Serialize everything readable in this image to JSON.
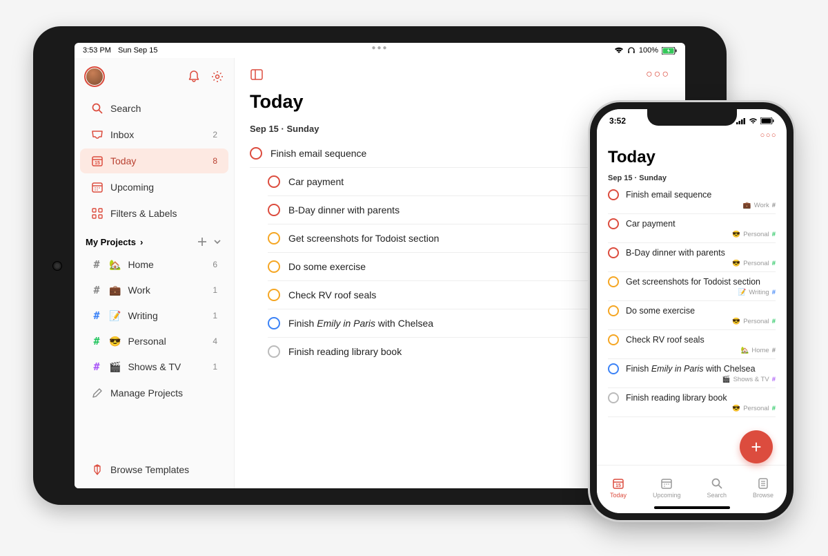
{
  "ipad": {
    "status": {
      "time": "3:53 PM",
      "date": "Sun Sep 15",
      "battery": "100%"
    },
    "sidebar": {
      "search": "Search",
      "nav": [
        {
          "label": "Inbox",
          "count": "2"
        },
        {
          "label": "Today",
          "count": "8"
        },
        {
          "label": "Upcoming",
          "count": ""
        },
        {
          "label": "Filters & Labels",
          "count": ""
        }
      ],
      "projects_header": "My Projects",
      "projects": [
        {
          "emoji": "🏡",
          "label": "Home",
          "count": "6",
          "hash": "gray"
        },
        {
          "emoji": "💼",
          "label": "Work",
          "count": "1",
          "hash": "gray"
        },
        {
          "emoji": "📝",
          "label": "Writing",
          "count": "1",
          "hash": "blue"
        },
        {
          "emoji": "😎",
          "label": "Personal",
          "count": "4",
          "hash": "green"
        },
        {
          "emoji": "🎬",
          "label": "Shows & TV",
          "count": "1",
          "hash": "purple"
        }
      ],
      "manage": "Manage Projects",
      "browse": "Browse Templates"
    },
    "main": {
      "title": "Today",
      "date": "Sep 15 · Sunday",
      "tasks": [
        {
          "text": "Finish email sequence",
          "priority": "red"
        },
        {
          "text": "Car payment",
          "priority": "red"
        },
        {
          "text": "B-Day dinner with parents",
          "priority": "red"
        },
        {
          "text": "Get screenshots for Todoist section",
          "priority": "orange"
        },
        {
          "text": "Do some exercise",
          "priority": "orange"
        },
        {
          "text": "Check RV roof seals",
          "priority": "orange"
        },
        {
          "text": "Finish Emily in Paris with Chelsea",
          "priority": "blue",
          "italic": "Emily in Paris"
        },
        {
          "text": "Finish reading library book",
          "priority": "gray"
        }
      ]
    }
  },
  "iphone": {
    "status": {
      "time": "3:52"
    },
    "title": "Today",
    "date": "Sep 15 · Sunday",
    "tasks": [
      {
        "text": "Finish email sequence",
        "priority": "red",
        "tag_emoji": "💼",
        "tag": "Work",
        "tag_color": "#888"
      },
      {
        "text": "Car payment",
        "priority": "red",
        "tag_emoji": "😎",
        "tag": "Personal",
        "tag_color": "#22c55e"
      },
      {
        "text": "B-Day dinner with parents",
        "priority": "red",
        "tag_emoji": "😎",
        "tag": "Personal",
        "tag_color": "#22c55e"
      },
      {
        "text": "Get screenshots for Todoist section",
        "priority": "orange",
        "tag_emoji": "📝",
        "tag": "Writing",
        "tag_color": "#3b82f6"
      },
      {
        "text": "Do some exercise",
        "priority": "orange",
        "tag_emoji": "😎",
        "tag": "Personal",
        "tag_color": "#22c55e"
      },
      {
        "text": "Check RV roof seals",
        "priority": "orange",
        "tag_emoji": "🏡",
        "tag": "Home",
        "tag_color": "#888"
      },
      {
        "text": "Finish Emily in Paris with Chelsea",
        "priority": "blue",
        "tag_emoji": "🎬",
        "tag": "Shows & TV",
        "tag_color": "#a855f7",
        "italic": "Emily in Paris"
      },
      {
        "text": "Finish reading library book",
        "priority": "gray",
        "tag_emoji": "😎",
        "tag": "Personal",
        "tag_color": "#22c55e"
      }
    ],
    "tabs": [
      {
        "label": "Today"
      },
      {
        "label": "Upcoming"
      },
      {
        "label": "Search"
      },
      {
        "label": "Browse"
      }
    ]
  }
}
